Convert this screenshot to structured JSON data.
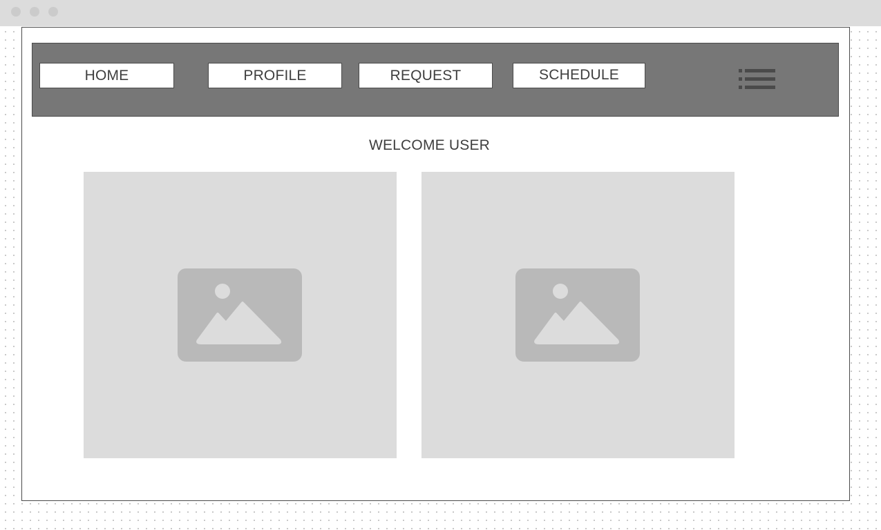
{
  "window": {
    "controls": [
      "close-dot",
      "minimize-dot",
      "maximize-dot"
    ]
  },
  "navbar": {
    "buttons": [
      {
        "label": "HOME"
      },
      {
        "label": "PROFILE"
      },
      {
        "label": "REQUEST"
      },
      {
        "label": "SCHEDULE"
      }
    ],
    "menu_icon": "hamburger-list-icon"
  },
  "main": {
    "welcome_text": "WELCOME USER",
    "images": [
      {
        "icon": "image-placeholder-icon"
      },
      {
        "icon": "image-placeholder-icon"
      }
    ]
  },
  "colors": {
    "navbar_bg": "#777777",
    "panel_bg": "#dcdcdc",
    "icon_fill": "#b9b9b9",
    "text": "#3e3e3e"
  }
}
